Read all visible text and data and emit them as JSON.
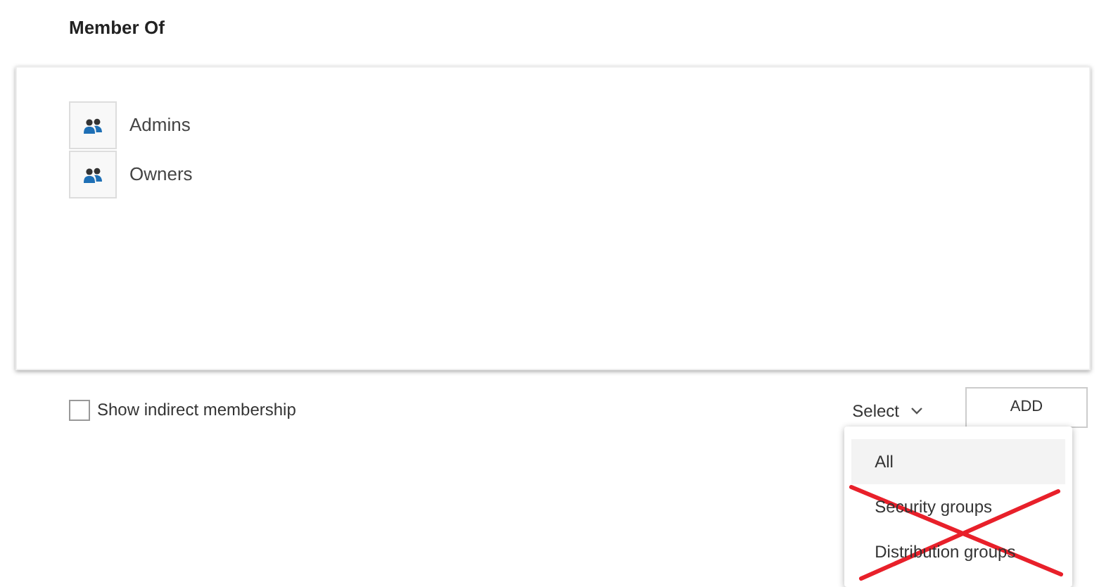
{
  "title": "Member Of",
  "groups": [
    {
      "name": "Admins"
    },
    {
      "name": "Owners"
    }
  ],
  "indirect_membership": {
    "label": "Show indirect membership",
    "checked": false
  },
  "filter": {
    "label": "Select",
    "options": [
      {
        "label": "All",
        "selected": true
      },
      {
        "label": "Security groups",
        "selected": false
      },
      {
        "label": "Distribution groups",
        "selected": false
      }
    ]
  },
  "add_button": {
    "label": "ADD"
  },
  "annotation": {
    "kind": "cross"
  }
}
